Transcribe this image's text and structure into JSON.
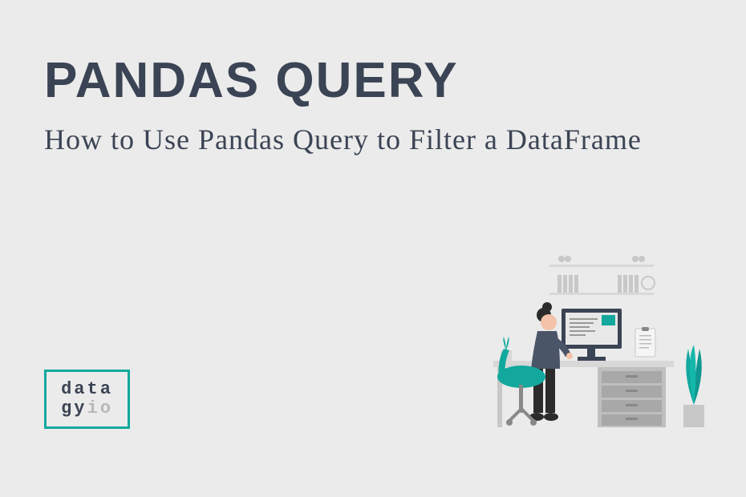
{
  "title": "PANDAS QUERY",
  "subtitle": "How to Use Pandas Query to Filter a DataFrame",
  "logo": {
    "line1": "data",
    "line2_part1": "gy",
    "line2_part2": "io"
  }
}
